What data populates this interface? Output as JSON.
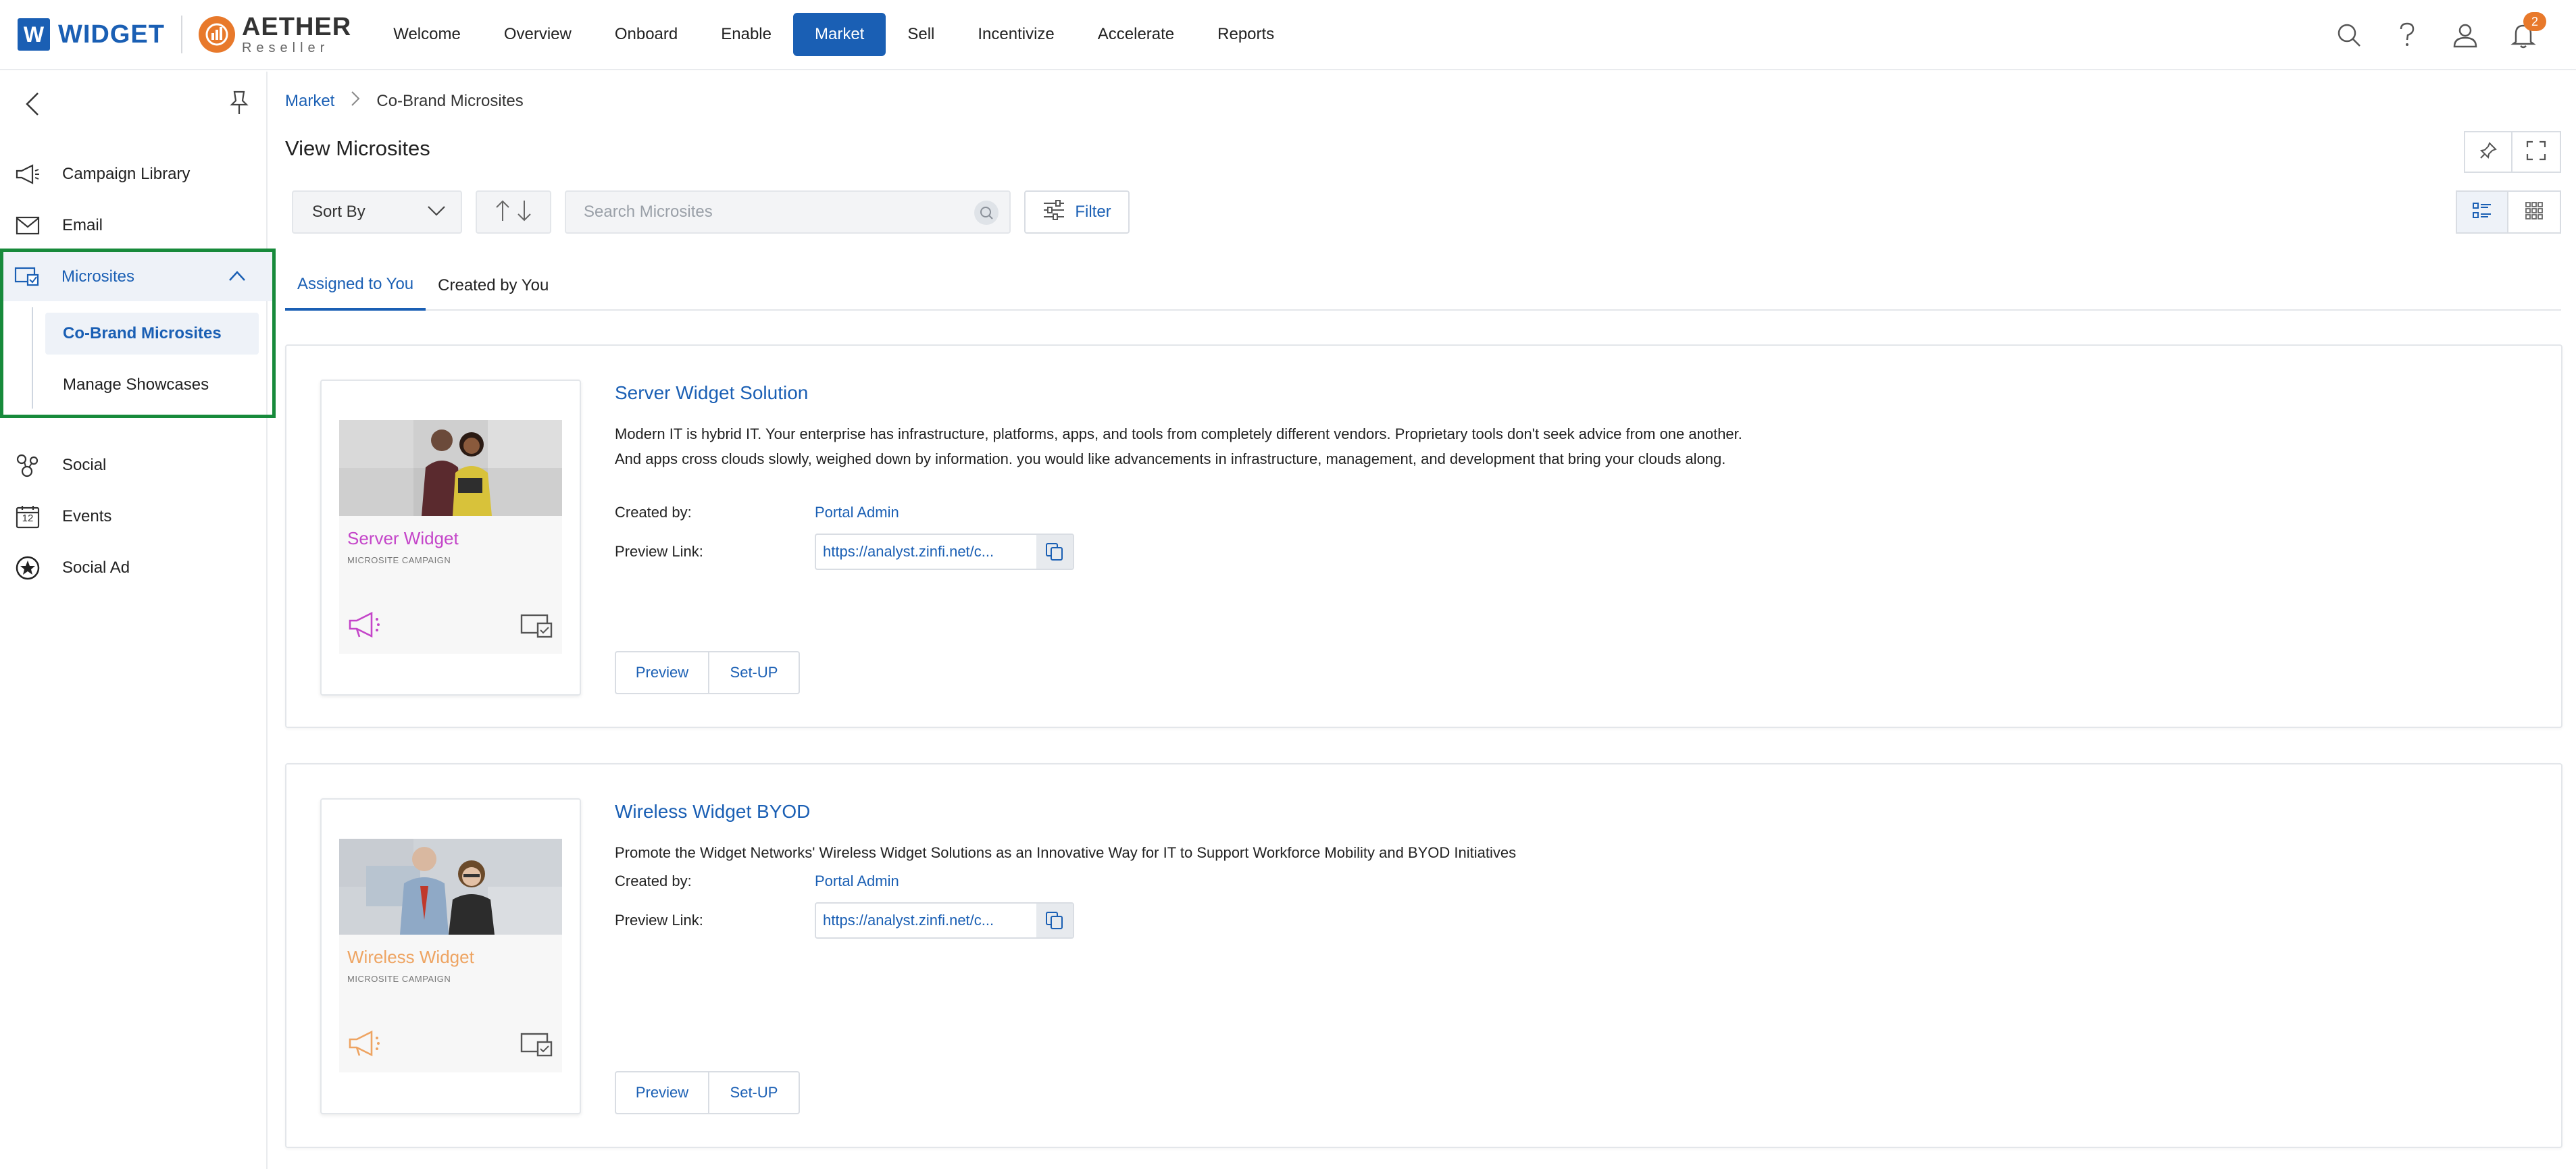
{
  "brand": {
    "widget_letter": "W",
    "widget_name": "WIDGET",
    "aether_name": "AETHER",
    "aether_sub": "Reseller"
  },
  "nav": {
    "items": [
      {
        "label": "Welcome"
      },
      {
        "label": "Overview"
      },
      {
        "label": "Onboard"
      },
      {
        "label": "Enable"
      },
      {
        "label": "Market",
        "active": true
      },
      {
        "label": "Sell"
      },
      {
        "label": "Incentivize"
      },
      {
        "label": "Accelerate"
      },
      {
        "label": "Reports"
      }
    ],
    "notifications_count": "2"
  },
  "sidebar": {
    "items": [
      {
        "label": "Campaign Library",
        "icon": "megaphone-icon"
      },
      {
        "label": "Email",
        "icon": "envelope-icon"
      },
      {
        "label": "Microsites",
        "icon": "microsite-icon",
        "expanded": true
      },
      {
        "label": "Social",
        "icon": "social-icon"
      },
      {
        "label": "Events",
        "icon": "calendar-icon"
      },
      {
        "label": "Social Ad",
        "icon": "star-badge-icon"
      }
    ],
    "microsites_children": [
      {
        "label": "Co-Brand Microsites",
        "active": true
      },
      {
        "label": "Manage Showcases"
      }
    ],
    "calendar_day": "12"
  },
  "breadcrumb": {
    "parent": "Market",
    "current": "Co-Brand Microsites"
  },
  "page": {
    "title": "View Microsites"
  },
  "toolbar": {
    "sort_label": "Sort By",
    "search_placeholder": "Search Microsites",
    "filter_label": "Filter"
  },
  "tabs": [
    {
      "label": "Assigned to You",
      "active": true
    },
    {
      "label": "Created by You"
    }
  ],
  "microsites": [
    {
      "title": "Server Widget Solution",
      "description": "Modern IT is hybrid IT. Your enterprise has infrastructure, platforms, apps, and tools from completely different vendors. Proprietary tools don't seek advice from one another. And apps cross clouds slowly, weighed down by information. you would like advancements in infrastructure, management, and development that bring your clouds along.",
      "created_by_label": "Created by:",
      "created_by": "Portal Admin",
      "preview_link_label": "Preview Link:",
      "preview_link": "https://analyst.zinfi.net/c...",
      "thumb_title": "Server Widget",
      "thumb_subtitle": "MICROSITE CAMPAIGN",
      "accent_color": "#c445c9",
      "preview_label": "Preview",
      "setup_label": "Set-UP"
    },
    {
      "title": "Wireless Widget BYOD",
      "description": "Promote the Widget Networks' Wireless Widget Solutions as an Innovative Way for IT to Support Workforce Mobility and BYOD Initiatives",
      "created_by_label": "Created by:",
      "created_by": "Portal Admin",
      "preview_link_label": "Preview Link:",
      "preview_link": "https://analyst.zinfi.net/c...",
      "thumb_title": "Wireless Widget",
      "thumb_subtitle": "MICROSITE CAMPAIGN",
      "accent_color": "#eea462",
      "preview_label": "Preview",
      "setup_label": "Set-UP"
    }
  ],
  "colors": {
    "primary": "#1a5fb4",
    "highlight_border": "#178a3b",
    "badge": "#e8792b"
  }
}
